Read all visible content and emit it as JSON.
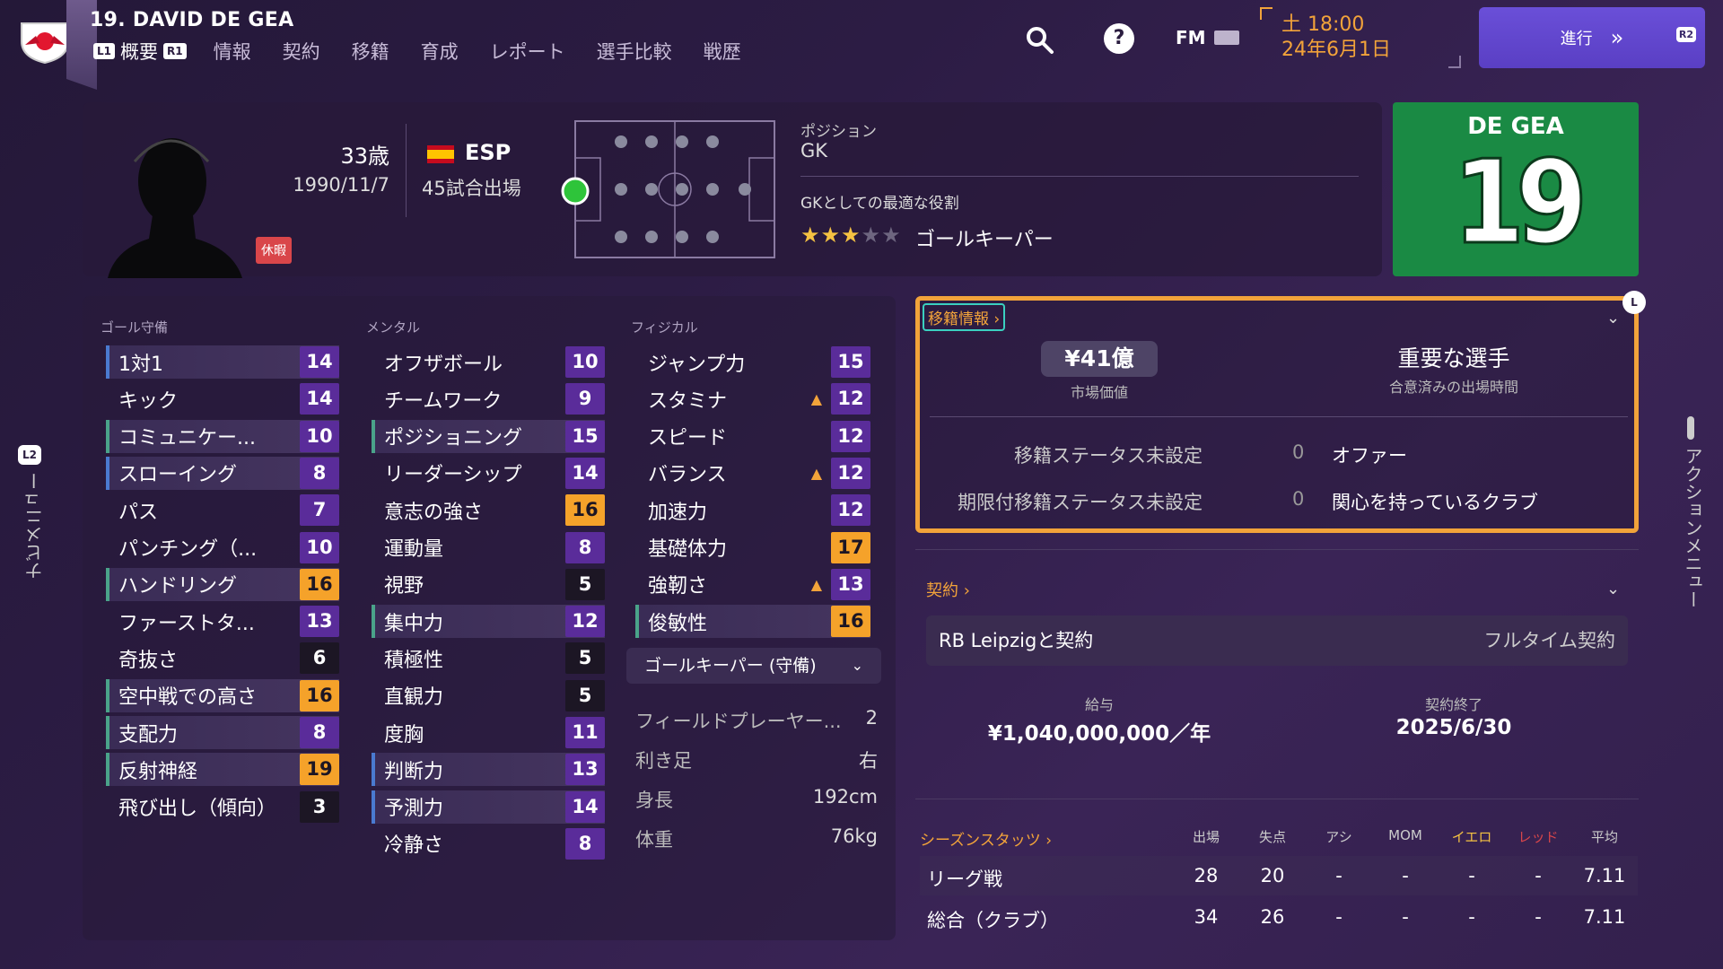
{
  "header": {
    "player": "19. DAVID DE GEA",
    "tabs": [
      "情報",
      "契約",
      "移籍",
      "育成",
      "レポート",
      "選手比較",
      "戦歴"
    ],
    "active_tab": "概要",
    "l1": "L1",
    "r1": "R1",
    "fm": "FM",
    "clock_day": "土 18:00",
    "clock_date": "24年6月1日",
    "continue": "進行",
    "continue_icon": "chevron-double-right-icon",
    "r2": "R2"
  },
  "profile": {
    "age": "33歳",
    "dob": "1990/11/7",
    "nation": "ESP",
    "apps": "45試合出場",
    "holiday": "休暇",
    "position_label": "ポジション",
    "position": "GK",
    "role_label": "GKとしての最適な役割",
    "role": "ゴールキーパー",
    "role_stars": 3,
    "role_stars_max": 5,
    "kit_name": "DE GEA",
    "kit_number": "19"
  },
  "attributes": {
    "gk_head": "ゴール守備",
    "mental_head": "メンタル",
    "physical_head": "フィジカル",
    "gk": [
      {
        "n": "1対1",
        "v": "14"
      },
      {
        "n": "キック",
        "v": "14"
      },
      {
        "n": "コミュニケー...",
        "v": "10"
      },
      {
        "n": "スローイング",
        "v": "8"
      },
      {
        "n": "パス",
        "v": "7"
      },
      {
        "n": "パンチング（...",
        "v": "10"
      },
      {
        "n": "ハンドリング",
        "v": "16"
      },
      {
        "n": "ファーストタ...",
        "v": "13"
      },
      {
        "n": "奇抜さ",
        "v": "6"
      },
      {
        "n": "空中戦での高さ",
        "v": "16"
      },
      {
        "n": "支配力",
        "v": "8"
      },
      {
        "n": "反射神経",
        "v": "19"
      },
      {
        "n": "飛び出し（傾向）",
        "v": "3"
      }
    ],
    "mental": [
      {
        "n": "オフザボール",
        "v": "10"
      },
      {
        "n": "チームワーク",
        "v": "9"
      },
      {
        "n": "ポジショニング",
        "v": "15"
      },
      {
        "n": "リーダーシップ",
        "v": "14"
      },
      {
        "n": "意志の強さ",
        "v": "16"
      },
      {
        "n": "運動量",
        "v": "8"
      },
      {
        "n": "視野",
        "v": "5"
      },
      {
        "n": "集中力",
        "v": "12"
      },
      {
        "n": "積極性",
        "v": "5"
      },
      {
        "n": "直観力",
        "v": "5"
      },
      {
        "n": "度胸",
        "v": "11"
      },
      {
        "n": "判断力",
        "v": "13"
      },
      {
        "n": "予測力",
        "v": "14"
      },
      {
        "n": "冷静さ",
        "v": "8"
      }
    ],
    "physical": [
      {
        "n": "ジャンプ力",
        "v": "15"
      },
      {
        "n": "スタミナ",
        "v": "12"
      },
      {
        "n": "スピード",
        "v": "12"
      },
      {
        "n": "バランス",
        "v": "12"
      },
      {
        "n": "加速力",
        "v": "12"
      },
      {
        "n": "基礎体力",
        "v": "17"
      },
      {
        "n": "強靭さ",
        "v": "13"
      },
      {
        "n": "俊敏性",
        "v": "16"
      }
    ],
    "role_dropdown": "ゴールキーパー (守備)",
    "info": [
      {
        "k": "フィールドプレーヤー...",
        "v": "2"
      },
      {
        "k": "利き足",
        "v": "右"
      },
      {
        "k": "身長",
        "v": "192cm"
      },
      {
        "k": "体重",
        "v": "76kg"
      }
    ]
  },
  "transfer": {
    "tag": "移籍情報",
    "clock": "L",
    "market_value": "¥41億",
    "market_label": "市場価値",
    "importance": "重要な選手",
    "importance_sub": "合意済みの出場時間",
    "status1": "移籍ステータス未設定",
    "count1": "0",
    "label1": "オファー",
    "status2": "期限付移籍ステータス未設定",
    "count2": "0",
    "label2": "関心を持っているクラブ"
  },
  "contract": {
    "label": "契約",
    "club": "RB Leipzigと契約",
    "type": "フルタイム契約",
    "wage_label": "給与",
    "wage": "¥1,040,000,000／年",
    "expiry_label": "契約終了",
    "expiry": "2025/6/30"
  },
  "stats": {
    "title": "シーズンスタッツ",
    "headers": [
      "出場",
      "失点",
      "アシ",
      "MOM",
      "イエロ",
      "レッド",
      "平均"
    ],
    "rows": [
      {
        "name": "リーグ戦",
        "vals": [
          "28",
          "20",
          "-",
          "-",
          "-",
          "-",
          "7.11"
        ]
      },
      {
        "name": "総合（クラブ）",
        "vals": [
          "34",
          "26",
          "-",
          "-",
          "-",
          "-",
          "7.11"
        ]
      }
    ]
  },
  "nav": {
    "left_l2": "L2",
    "left": "ナビメニュー",
    "right": "アクションメニュー"
  },
  "colors": {
    "accent_orange": "#f2a33a",
    "accent_purple": "#5a2c9a",
    "kit_green": "#1a8a44",
    "continue_purple": "#5a3fc4"
  }
}
